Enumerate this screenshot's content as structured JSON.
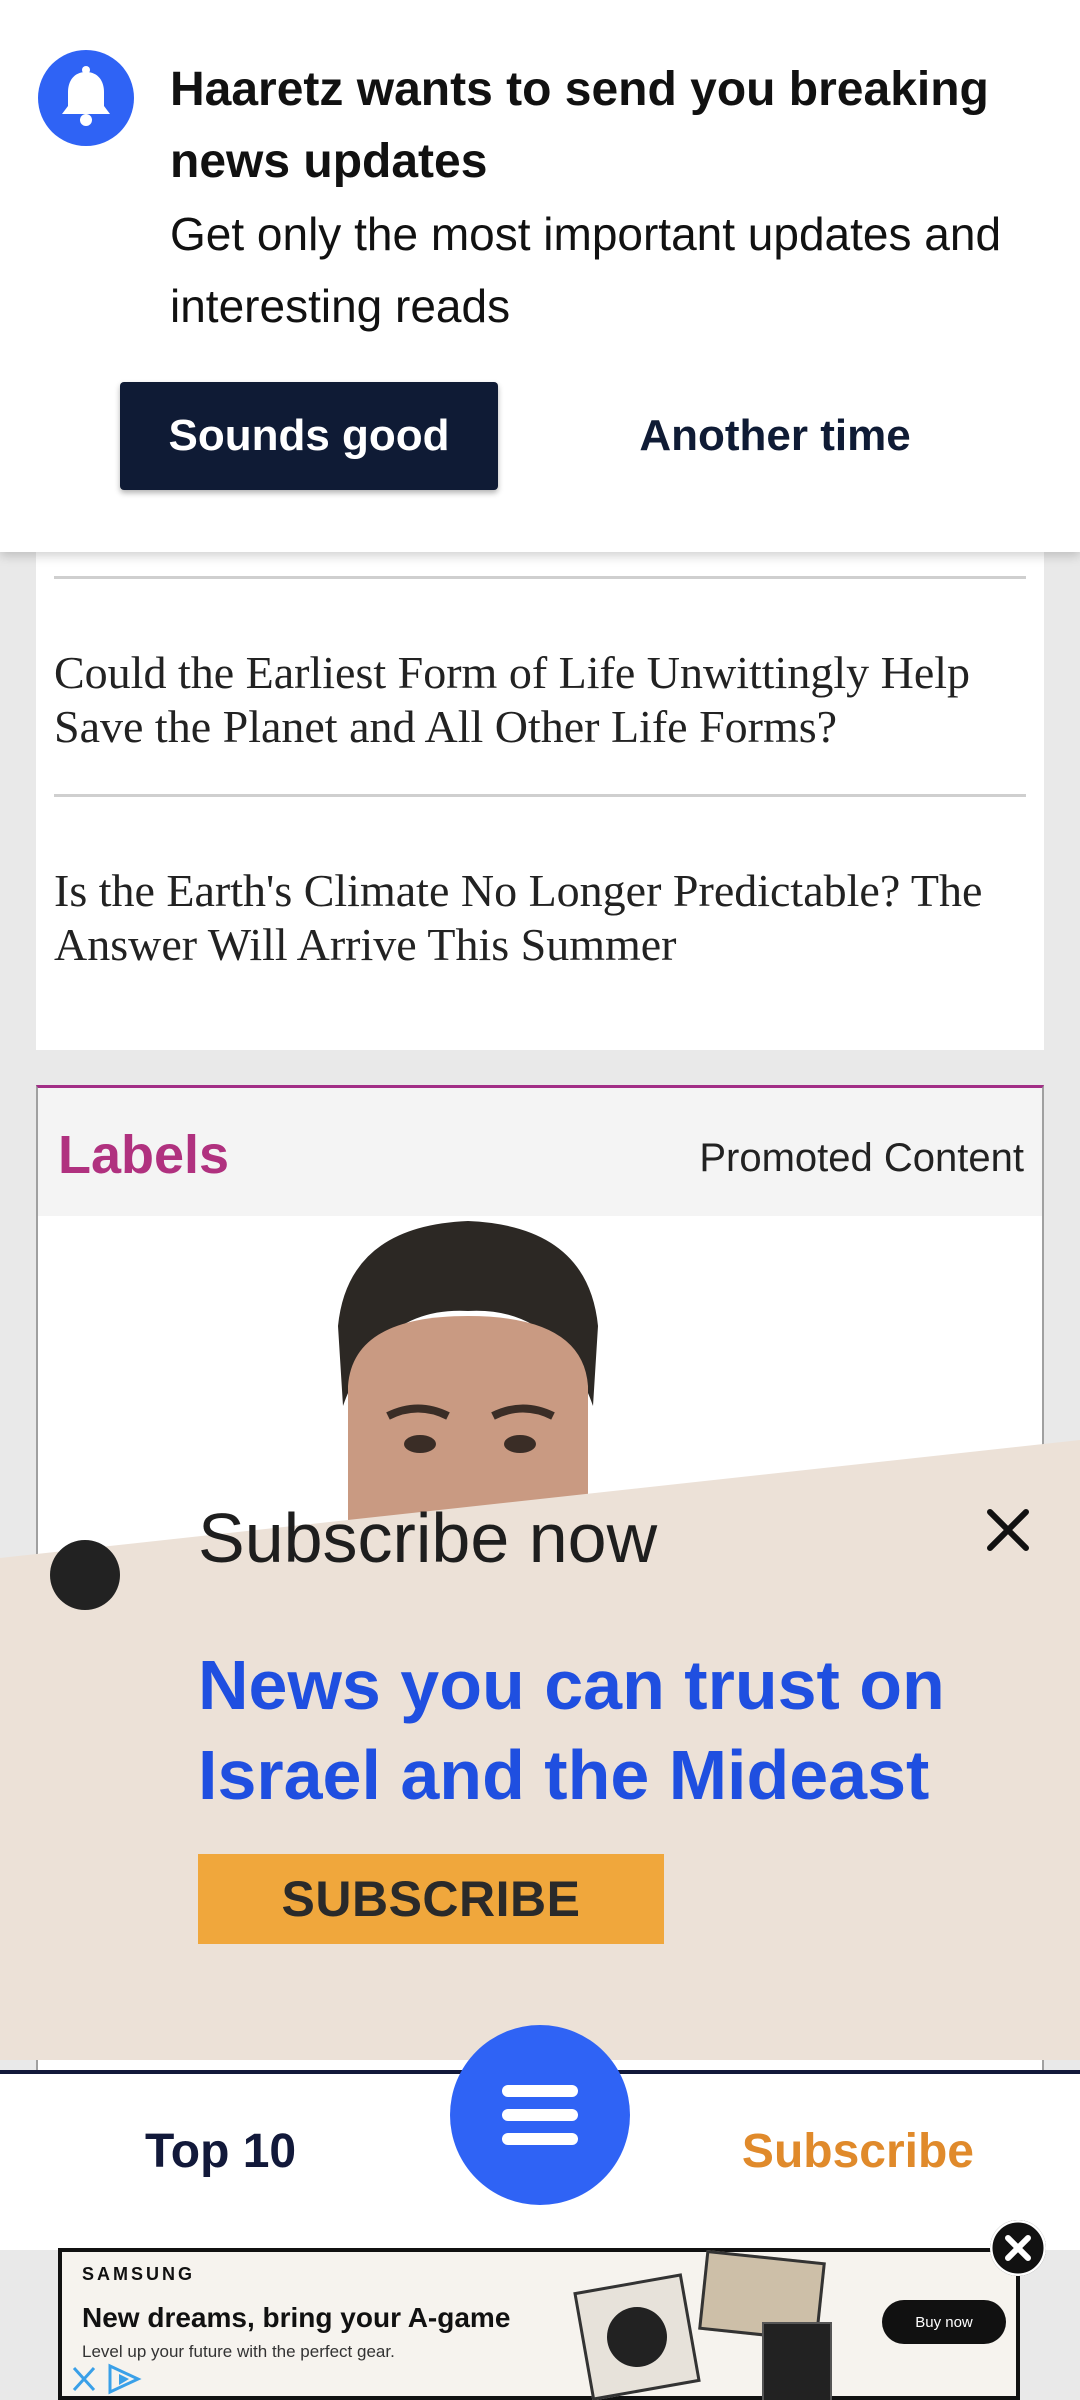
{
  "notification": {
    "title": "Haaretz wants to send you breaking news updates",
    "body": "Get only the most important updates and interesting reads",
    "accept_label": "Sounds good",
    "decline_label": "Another time",
    "icon": "bell-icon"
  },
  "articles": [
    {
      "title": "Could the Earliest Form of Life Unwittingly Help Save the Planet and All Other Life Forms?"
    },
    {
      "title": "Is the Earth's Climate No Longer Predictable? The Answer Will Arrive This Summer"
    }
  ],
  "promo": {
    "title": "Labels",
    "label": "Promoted Content"
  },
  "subscribe_overlay": {
    "heading": "Subscribe now",
    "headline": "News you can trust on Israel and the Mideast",
    "button_label": "SUBSCRIBE",
    "close_icon": "close-icon"
  },
  "bottom_nav": {
    "left_label": "Top 10",
    "right_label": "Subscribe",
    "menu_icon": "hamburger-menu-icon"
  },
  "ad": {
    "brand": "SAMSUNG",
    "headline": "New dreams, bring your A-game",
    "subtext": "Level up your future with the perfect gear.",
    "cta": "Buy now"
  },
  "colors": {
    "brand_blue": "#2f63f5",
    "navy": "#0f1b35",
    "promo_magenta": "#b0317f",
    "subscribe_orange": "#e08a2b",
    "subscribe_button": "#f0a73c",
    "overlay_bg": "#ece1d7",
    "headline_blue": "#1f4fe0"
  }
}
